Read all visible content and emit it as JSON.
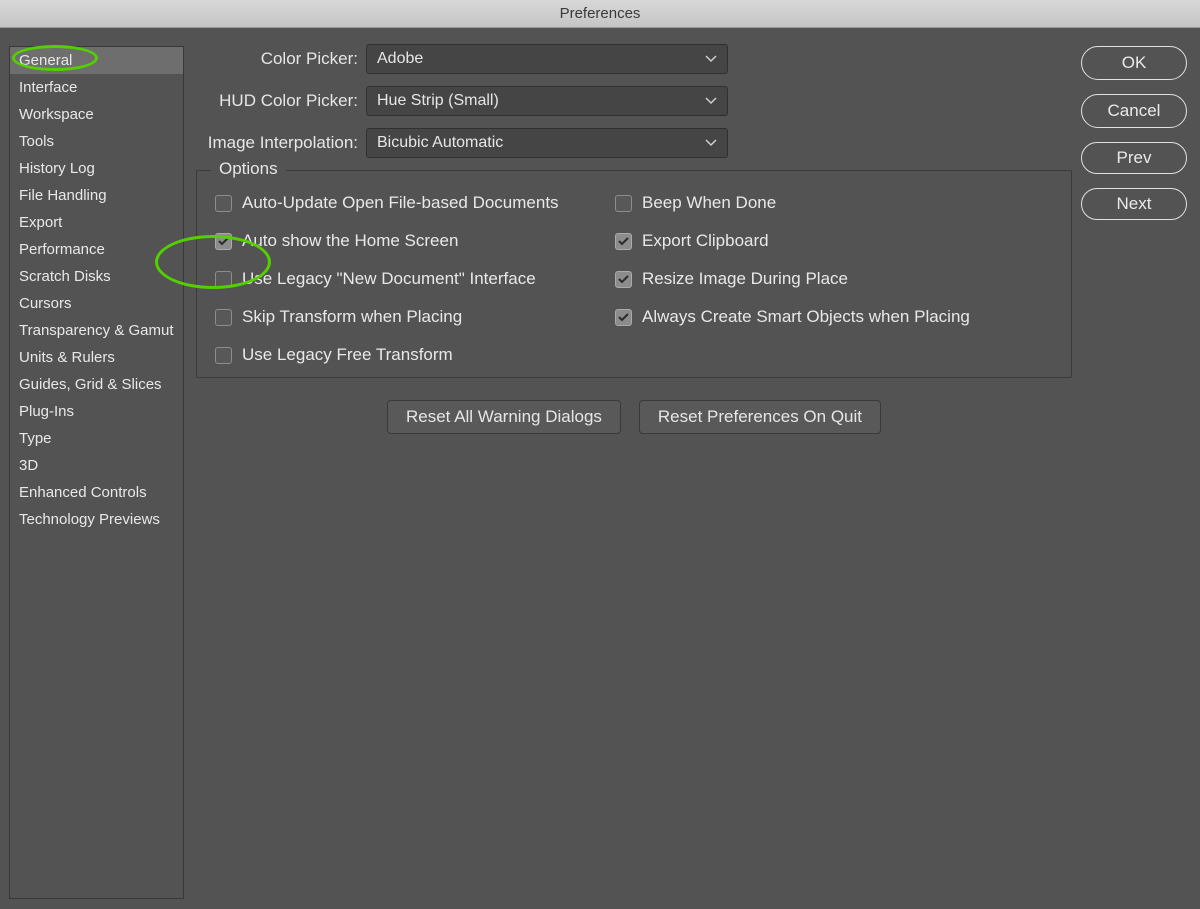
{
  "title": "Preferences",
  "sidebar": {
    "items": [
      {
        "label": "General",
        "selected": true
      },
      {
        "label": "Interface"
      },
      {
        "label": "Workspace"
      },
      {
        "label": "Tools"
      },
      {
        "label": "History Log"
      },
      {
        "label": "File Handling"
      },
      {
        "label": "Export"
      },
      {
        "label": "Performance"
      },
      {
        "label": "Scratch Disks"
      },
      {
        "label": "Cursors"
      },
      {
        "label": "Transparency & Gamut"
      },
      {
        "label": "Units & Rulers"
      },
      {
        "label": "Guides, Grid & Slices"
      },
      {
        "label": "Plug-Ins"
      },
      {
        "label": "Type"
      },
      {
        "label": "3D"
      },
      {
        "label": "Enhanced Controls"
      },
      {
        "label": "Technology Previews"
      }
    ]
  },
  "buttons": {
    "ok": "OK",
    "cancel": "Cancel",
    "prev": "Prev",
    "next": "Next"
  },
  "selects": {
    "color_picker": {
      "label": "Color Picker:",
      "value": "Adobe"
    },
    "hud_color_picker": {
      "label": "HUD Color Picker:",
      "value": "Hue Strip (Small)"
    },
    "image_interpolation": {
      "label": "Image Interpolation:",
      "value": "Bicubic Automatic"
    }
  },
  "options_legend": "Options",
  "options": {
    "left": [
      {
        "label": "Auto-Update Open File-based Documents",
        "checked": false
      },
      {
        "label": "Auto show the Home Screen",
        "checked": true
      },
      {
        "label": "Use Legacy \"New Document\" Interface",
        "checked": false
      },
      {
        "label": "Skip Transform when Placing",
        "checked": false
      },
      {
        "label": "Use Legacy Free Transform",
        "checked": false
      }
    ],
    "right": [
      {
        "label": "Beep When Done",
        "checked": false
      },
      {
        "label": "Export Clipboard",
        "checked": true
      },
      {
        "label": "Resize Image During Place",
        "checked": true
      },
      {
        "label": "Always Create Smart Objects when Placing",
        "checked": true
      }
    ]
  },
  "bottom_buttons": {
    "reset_warnings": "Reset All Warning Dialogs",
    "reset_prefs": "Reset Preferences On Quit"
  },
  "annotation_color": "#54d000"
}
